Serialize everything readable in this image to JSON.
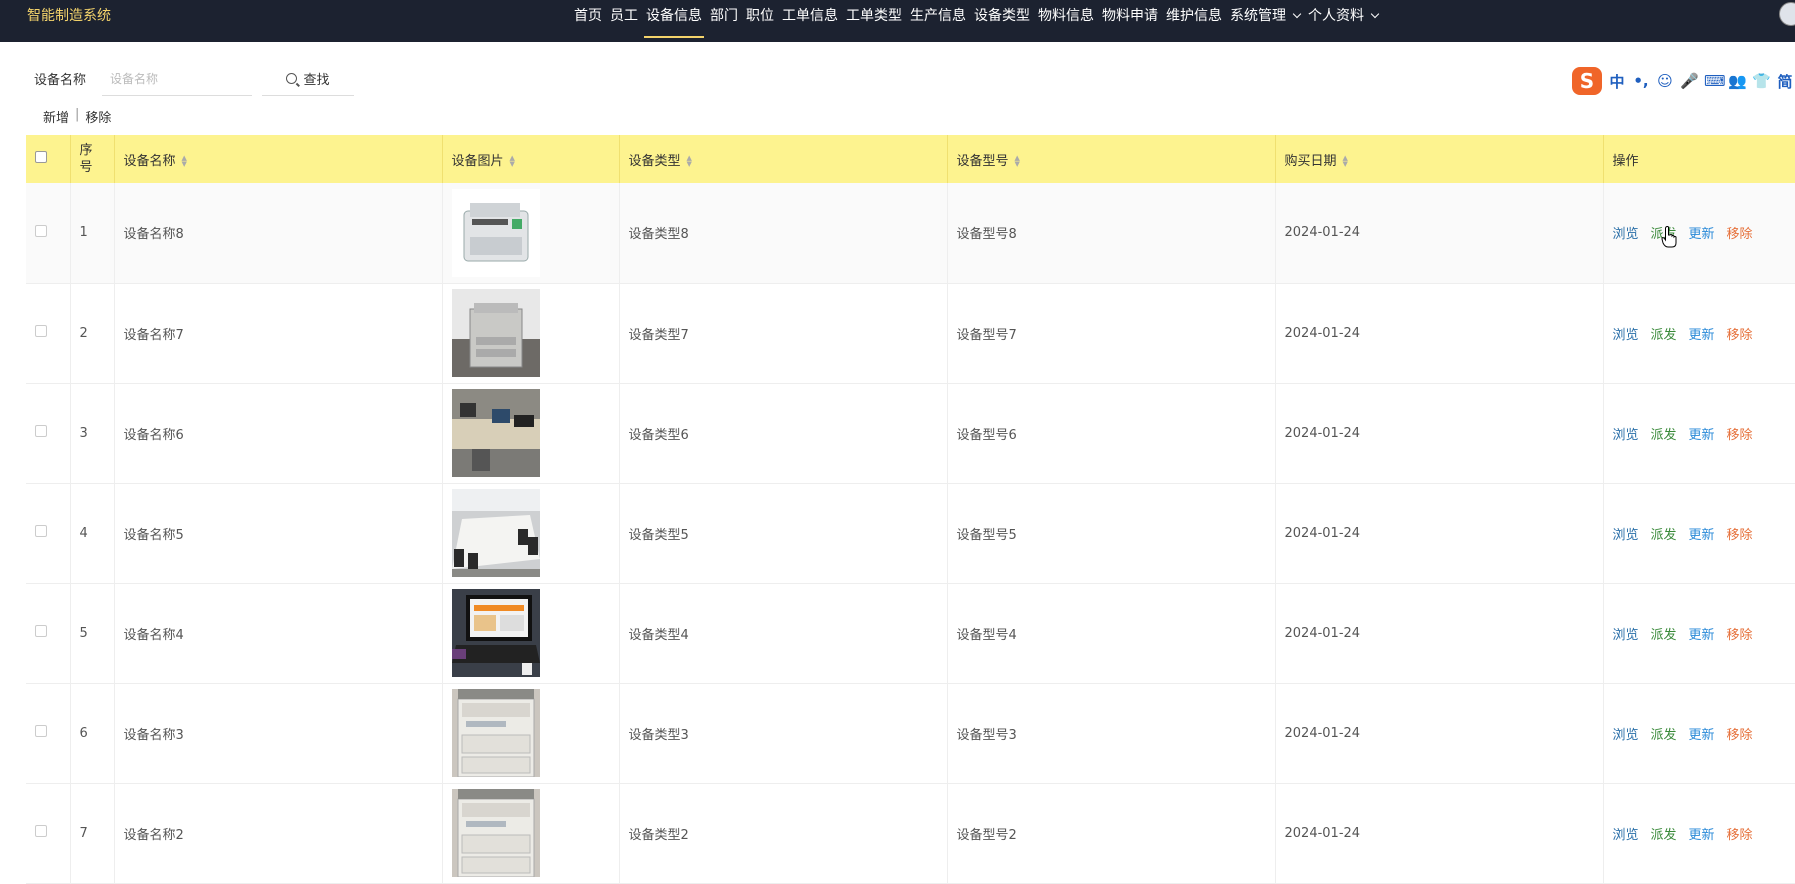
{
  "app": {
    "title": "智能制造系统"
  },
  "nav": {
    "items": [
      {
        "label": "首页",
        "active": false,
        "dropdown": false
      },
      {
        "label": "员工",
        "active": false,
        "dropdown": false
      },
      {
        "label": "设备信息",
        "active": true,
        "dropdown": false
      },
      {
        "label": "部门",
        "active": false,
        "dropdown": false
      },
      {
        "label": "职位",
        "active": false,
        "dropdown": false
      },
      {
        "label": "工单信息",
        "active": false,
        "dropdown": false
      },
      {
        "label": "工单类型",
        "active": false,
        "dropdown": false
      },
      {
        "label": "生产信息",
        "active": false,
        "dropdown": false
      },
      {
        "label": "设备类型",
        "active": false,
        "dropdown": false
      },
      {
        "label": "物料信息",
        "active": false,
        "dropdown": false
      },
      {
        "label": "物料申请",
        "active": false,
        "dropdown": false
      },
      {
        "label": "维护信息",
        "active": false,
        "dropdown": false
      },
      {
        "label": "系统管理",
        "active": false,
        "dropdown": true
      },
      {
        "label": "个人资料",
        "active": false,
        "dropdown": true
      }
    ]
  },
  "search": {
    "label": "设备名称",
    "placeholder": "设备名称",
    "value": "",
    "button_label": "查找"
  },
  "toolbar": {
    "add_label": "新增",
    "separator": "|",
    "remove_label": "移除"
  },
  "ime": {
    "logo": "S",
    "items": [
      "中",
      "•,",
      "☺",
      "🎤",
      "⌨",
      "👥",
      "👕",
      "简"
    ]
  },
  "table": {
    "headers": {
      "index": "序号",
      "name": "设备名称",
      "image": "设备图片",
      "type": "设备类型",
      "model": "设备型号",
      "date": "购买日期",
      "ops": "操作"
    },
    "ops": {
      "view": "浏览",
      "dispatch": "派发",
      "update": "更新",
      "remove": "移除"
    },
    "rows": [
      {
        "index": "1",
        "name": "设备名称8",
        "image_icon": "printer-photo",
        "type": "设备类型8",
        "model": "设备型号8",
        "date": "2024-01-24"
      },
      {
        "index": "2",
        "name": "设备名称7",
        "image_icon": "copier-photo",
        "type": "设备类型7",
        "model": "设备型号7",
        "date": "2024-01-24"
      },
      {
        "index": "3",
        "name": "设备名称6",
        "image_icon": "office-photo",
        "type": "设备类型6",
        "model": "设备型号6",
        "date": "2024-01-24"
      },
      {
        "index": "4",
        "name": "设备名称5",
        "image_icon": "meeting-room-photo",
        "type": "设备类型5",
        "model": "设备型号5",
        "date": "2024-01-24"
      },
      {
        "index": "5",
        "name": "设备名称4",
        "image_icon": "laptop-photo",
        "type": "设备类型4",
        "model": "设备型号4",
        "date": "2024-01-24"
      },
      {
        "index": "6",
        "name": "设备名称3",
        "image_icon": "large-copier-photo",
        "type": "设备类型3",
        "model": "设备型号3",
        "date": "2024-01-24"
      },
      {
        "index": "7",
        "name": "设备名称2",
        "image_icon": "large-copier-photo",
        "type": "设备类型2",
        "model": "设备型号2",
        "date": "2024-01-24"
      }
    ]
  },
  "colors": {
    "topbar_bg": "#1c2230",
    "brand": "#f3d36b",
    "header_bg": "#fdf38f",
    "op_view": "#2a6fa8",
    "op_dispatch": "#3a8a3a",
    "op_update": "#2a8ad8",
    "op_remove": "#e6703a"
  }
}
